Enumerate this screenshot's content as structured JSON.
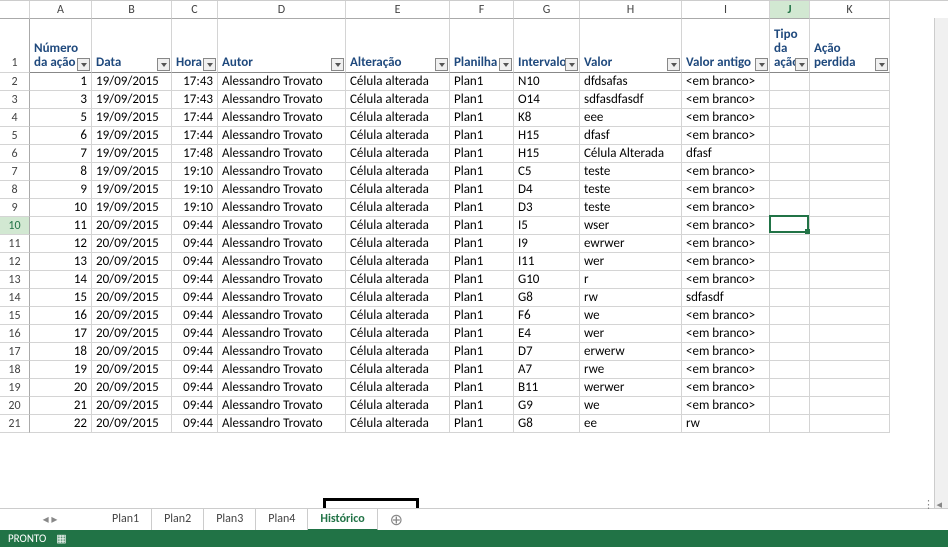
{
  "colheads": [
    "A",
    "B",
    "C",
    "D",
    "E",
    "F",
    "G",
    "H",
    "I",
    "J",
    "K"
  ],
  "selected_col_index": 9,
  "headers": [
    "Número da ação",
    "Data",
    "Hora",
    "Autor",
    "Alteração",
    "Planilha",
    "Intervalo",
    "Valor",
    "Valor antigo",
    "Tipo da ação",
    "Ação perdida"
  ],
  "rows": [
    {
      "n": "1",
      "d": "19/09/2015",
      "h": "17:43",
      "a": "Alessandro Trovato",
      "alt": "Célula alterada",
      "p": "Plan1",
      "i": "N10",
      "v": "dfdsafas",
      "va": "<em branco>"
    },
    {
      "n": "3",
      "d": "19/09/2015",
      "h": "17:43",
      "a": "Alessandro Trovato",
      "alt": "Célula alterada",
      "p": "Plan1",
      "i": "O14",
      "v": "sdfasdfasdf",
      "va": "<em branco>"
    },
    {
      "n": "5",
      "d": "19/09/2015",
      "h": "17:44",
      "a": "Alessandro Trovato",
      "alt": "Célula alterada",
      "p": "Plan1",
      "i": "K8",
      "v": "eee",
      "va": "<em branco>"
    },
    {
      "n": "6",
      "d": "19/09/2015",
      "h": "17:44",
      "a": "Alessandro Trovato",
      "alt": "Célula alterada",
      "p": "Plan1",
      "i": "H15",
      "v": "dfasf",
      "va": "<em branco>"
    },
    {
      "n": "7",
      "d": "19/09/2015",
      "h": "17:48",
      "a": "Alessandro Trovato",
      "alt": "Célula alterada",
      "p": "Plan1",
      "i": "H15",
      "v": "Célula Alterada",
      "va": "dfasf"
    },
    {
      "n": "8",
      "d": "19/09/2015",
      "h": "19:10",
      "a": "Alessandro Trovato",
      "alt": "Célula alterada",
      "p": "Plan1",
      "i": "C5",
      "v": "teste",
      "va": "<em branco>"
    },
    {
      "n": "9",
      "d": "19/09/2015",
      "h": "19:10",
      "a": "Alessandro Trovato",
      "alt": "Célula alterada",
      "p": "Plan1",
      "i": "D4",
      "v": "teste",
      "va": "<em branco>"
    },
    {
      "n": "10",
      "d": "19/09/2015",
      "h": "19:10",
      "a": "Alessandro Trovato",
      "alt": "Célula alterada",
      "p": "Plan1",
      "i": "D3",
      "v": "teste",
      "va": "<em branco>"
    },
    {
      "n": "11",
      "d": "20/09/2015",
      "h": "09:44",
      "a": "Alessandro Trovato",
      "alt": "Célula alterada",
      "p": "Plan1",
      "i": "I5",
      "v": "wser",
      "va": "<em branco>"
    },
    {
      "n": "12",
      "d": "20/09/2015",
      "h": "09:44",
      "a": "Alessandro Trovato",
      "alt": "Célula alterada",
      "p": "Plan1",
      "i": "I9",
      "v": "ewrwer",
      "va": "<em branco>"
    },
    {
      "n": "13",
      "d": "20/09/2015",
      "h": "09:44",
      "a": "Alessandro Trovato",
      "alt": "Célula alterada",
      "p": "Plan1",
      "i": "I11",
      "v": "wer",
      "va": "<em branco>"
    },
    {
      "n": "14",
      "d": "20/09/2015",
      "h": "09:44",
      "a": "Alessandro Trovato",
      "alt": "Célula alterada",
      "p": "Plan1",
      "i": "G10",
      "v": "r",
      "va": "<em branco>"
    },
    {
      "n": "15",
      "d": "20/09/2015",
      "h": "09:44",
      "a": "Alessandro Trovato",
      "alt": "Célula alterada",
      "p": "Plan1",
      "i": "G8",
      "v": "rw",
      "va": "sdfasdf"
    },
    {
      "n": "16",
      "d": "20/09/2015",
      "h": "09:44",
      "a": "Alessandro Trovato",
      "alt": "Célula alterada",
      "p": "Plan1",
      "i": "F6",
      "v": "we",
      "va": "<em branco>"
    },
    {
      "n": "17",
      "d": "20/09/2015",
      "h": "09:44",
      "a": "Alessandro Trovato",
      "alt": "Célula alterada",
      "p": "Plan1",
      "i": "E4",
      "v": "wer",
      "va": "<em branco>"
    },
    {
      "n": "18",
      "d": "20/09/2015",
      "h": "09:44",
      "a": "Alessandro Trovato",
      "alt": "Célula alterada",
      "p": "Plan1",
      "i": "D7",
      "v": "erwerw",
      "va": "<em branco>"
    },
    {
      "n": "19",
      "d": "20/09/2015",
      "h": "09:44",
      "a": "Alessandro Trovato",
      "alt": "Célula alterada",
      "p": "Plan1",
      "i": "A7",
      "v": "rwe",
      "va": "<em branco>"
    },
    {
      "n": "20",
      "d": "20/09/2015",
      "h": "09:44",
      "a": "Alessandro Trovato",
      "alt": "Célula alterada",
      "p": "Plan1",
      "i": "B11",
      "v": "werwer",
      "va": "<em branco>"
    },
    {
      "n": "21",
      "d": "20/09/2015",
      "h": "09:44",
      "a": "Alessandro Trovato",
      "alt": "Célula alterada",
      "p": "Plan1",
      "i": "G9",
      "v": "we",
      "va": "<em branco>"
    },
    {
      "n": "22",
      "d": "20/09/2015",
      "h": "09:44",
      "a": "Alessandro Trovato",
      "alt": "Célula alterada",
      "p": "Plan1",
      "i": "G8",
      "v": "ee",
      "va": "rw"
    }
  ],
  "active_row_index": 8,
  "tabs": [
    "Plan1",
    "Plan2",
    "Plan3",
    "Plan4",
    "Histórico"
  ],
  "active_tab_index": 4,
  "status": {
    "label": "PRONTO"
  },
  "tab_nav": "◂  ▸",
  "add_tab": "⊕",
  "scroll_right": "⋮   ◂"
}
